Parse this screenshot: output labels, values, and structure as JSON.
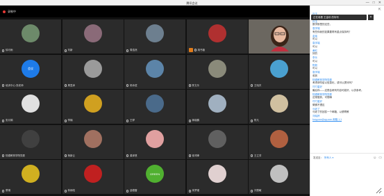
{
  "window": {
    "title": "腾讯会议",
    "min_icon": "—",
    "max_icon": "□",
    "close_icon": "✕"
  },
  "topbar": {
    "recording_label": "录制中"
  },
  "tiles": [
    {
      "name": "徐可雨",
      "color": "#6d8a6a",
      "avatar_text": ""
    },
    {
      "name": "刘新",
      "color": "#8a6a78",
      "avatar_text": ""
    },
    {
      "name": "周浩然",
      "color": "#6d7f8f",
      "avatar_text": ""
    },
    {
      "name": "胡书薇",
      "color": "#b03030",
      "avatar_text": "",
      "host": true
    },
    {
      "name": "",
      "color": "#6b6760",
      "avatar_text": "",
      "speaker": true
    },
    {
      "name": "培训中心-张老师",
      "color": "#1e7be8",
      "avatar_text": "会议"
    },
    {
      "name": "周显泽",
      "color": "#9a9a9a",
      "avatar_text": ""
    },
    {
      "name": "杨永斌",
      "color": "#5c84a8",
      "avatar_text": ""
    },
    {
      "name": "陈文乐",
      "color": "#8a8a7a",
      "avatar_text": ""
    },
    {
      "name": "王晓东",
      "color": "#4aa0d0",
      "avatar_text": ""
    },
    {
      "name": "张月娟",
      "color": "#e0e0e0",
      "avatar_text": ""
    },
    {
      "name": "李楠",
      "color": "#d0a020",
      "avatar_text": ""
    },
    {
      "name": "王骅",
      "color": "#4a6a8a",
      "avatar_text": ""
    },
    {
      "name": "蒋晓鹏",
      "color": "#a0b0c0",
      "avatar_text": ""
    },
    {
      "name": "陈凡",
      "color": "#d0c0a0",
      "avatar_text": ""
    },
    {
      "name": "陆德教育学院党委",
      "color": "#404040",
      "avatar_text": ""
    },
    {
      "name": "杨新云",
      "color": "#a07060",
      "avatar_text": ""
    },
    {
      "name": "龚泽慧",
      "color": "#e0a0a0",
      "avatar_text": ""
    },
    {
      "name": "徐鸿锋",
      "color": "#606060",
      "avatar_text": ""
    },
    {
      "name": "王立芳",
      "color": "#b06040",
      "avatar_text": ""
    },
    {
      "name": "蔡娟",
      "color": "#d0b020",
      "avatar_text": ""
    },
    {
      "name": "林雨晗",
      "color": "#c02020",
      "avatar_text": ""
    },
    {
      "name": "曲德雷",
      "color": "#50b030",
      "avatar_text": "GREEN"
    },
    {
      "name": "朱梦瑾",
      "color": "#e0d0d0",
      "avatar_text": ""
    },
    {
      "name": "刘慧敏",
      "color": "#c0c0c0",
      "avatar_text": ""
    }
  ],
  "chat": {
    "header_icon": "⇱",
    "notice": "正在收看 王金珍 的特写",
    "notice_close": "×",
    "messages": [
      {
        "who": "孙玉",
        "text": "老师这样，应该能看清晰"
      },
      {
        "who": "孙玉",
        "text": "数学那里的这些，"
      },
      {
        "who": "袁学端",
        "text": "有些你我的如果要再有重点保持吗？"
      },
      {
        "who": "金瑶",
        "text": "可以"
      },
      {
        "who": "袁学端",
        "text": "可以"
      },
      {
        "who": "黄虹",
        "text": "好的"
      },
      {
        "who": "李乐",
        "text": "可以"
      },
      {
        "who": "陈毅",
        "text": "可以"
      },
      {
        "who": "袁学端",
        "text": "收到"
      },
      {
        "who": "陆德教育学院党委",
        "text": "考虑请勿给以信息化，或可以提问吗？"
      },
      {
        "who": "叮叮星好",
        "text": "最后你——这很会研判内容可能好，以供参考。"
      },
      {
        "who": "陆德教育学院党委",
        "text": "这常做到，可惜嘛"
      },
      {
        "who": "叮叮星好",
        "text": "微微不透应"
      },
      {
        "who": "马老了",
        "text": "马老了的回答一个邮箱，以便寄教"
      },
      {
        "who": "刘晓婷",
        "text": "fxxyyxxx@qq.com 邮箱 1.1",
        "link": true
      }
    ],
    "send_to_label": "发送至：",
    "send_to_value": "所有人 ▾",
    "emoji_icon": "☺",
    "file_icon": "▭",
    "input_placeholder": ""
  }
}
